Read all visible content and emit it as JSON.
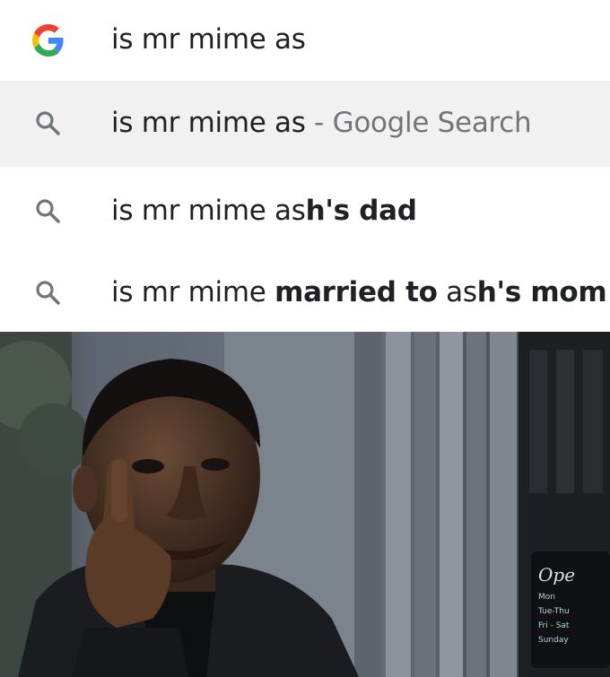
{
  "search": {
    "query": "is mr mime as",
    "icon": "google-g-icon"
  },
  "suggestions": [
    {
      "icon": "search-icon",
      "prefix": "is mr mime as",
      "bold": "",
      "tail": "",
      "suffix": " - Google Search",
      "highlighted": true
    },
    {
      "icon": "search-icon",
      "prefix": "is mr mime as",
      "bold": "h's dad",
      "tail": "",
      "suffix": "",
      "highlighted": false
    },
    {
      "icon": "search-icon",
      "prefix": "is mr mime ",
      "bold": "married to",
      "mid": " as",
      "bold2": "h's mom",
      "suffix": "",
      "highlighted": false
    }
  ],
  "colors": {
    "highlight_row": "#f1f1f1",
    "suffix_text": "#70757a",
    "text": "#202124",
    "google_blue": "#4285f4",
    "google_red": "#ea4335",
    "google_yellow": "#fbbc05",
    "google_green": "#34a853"
  },
  "photo": {
    "description_icon": "meme-photo",
    "sign_text": [
      "Ope",
      "Mon",
      "Tue-Thu",
      "Fri - Sat",
      "Sunday"
    ]
  }
}
